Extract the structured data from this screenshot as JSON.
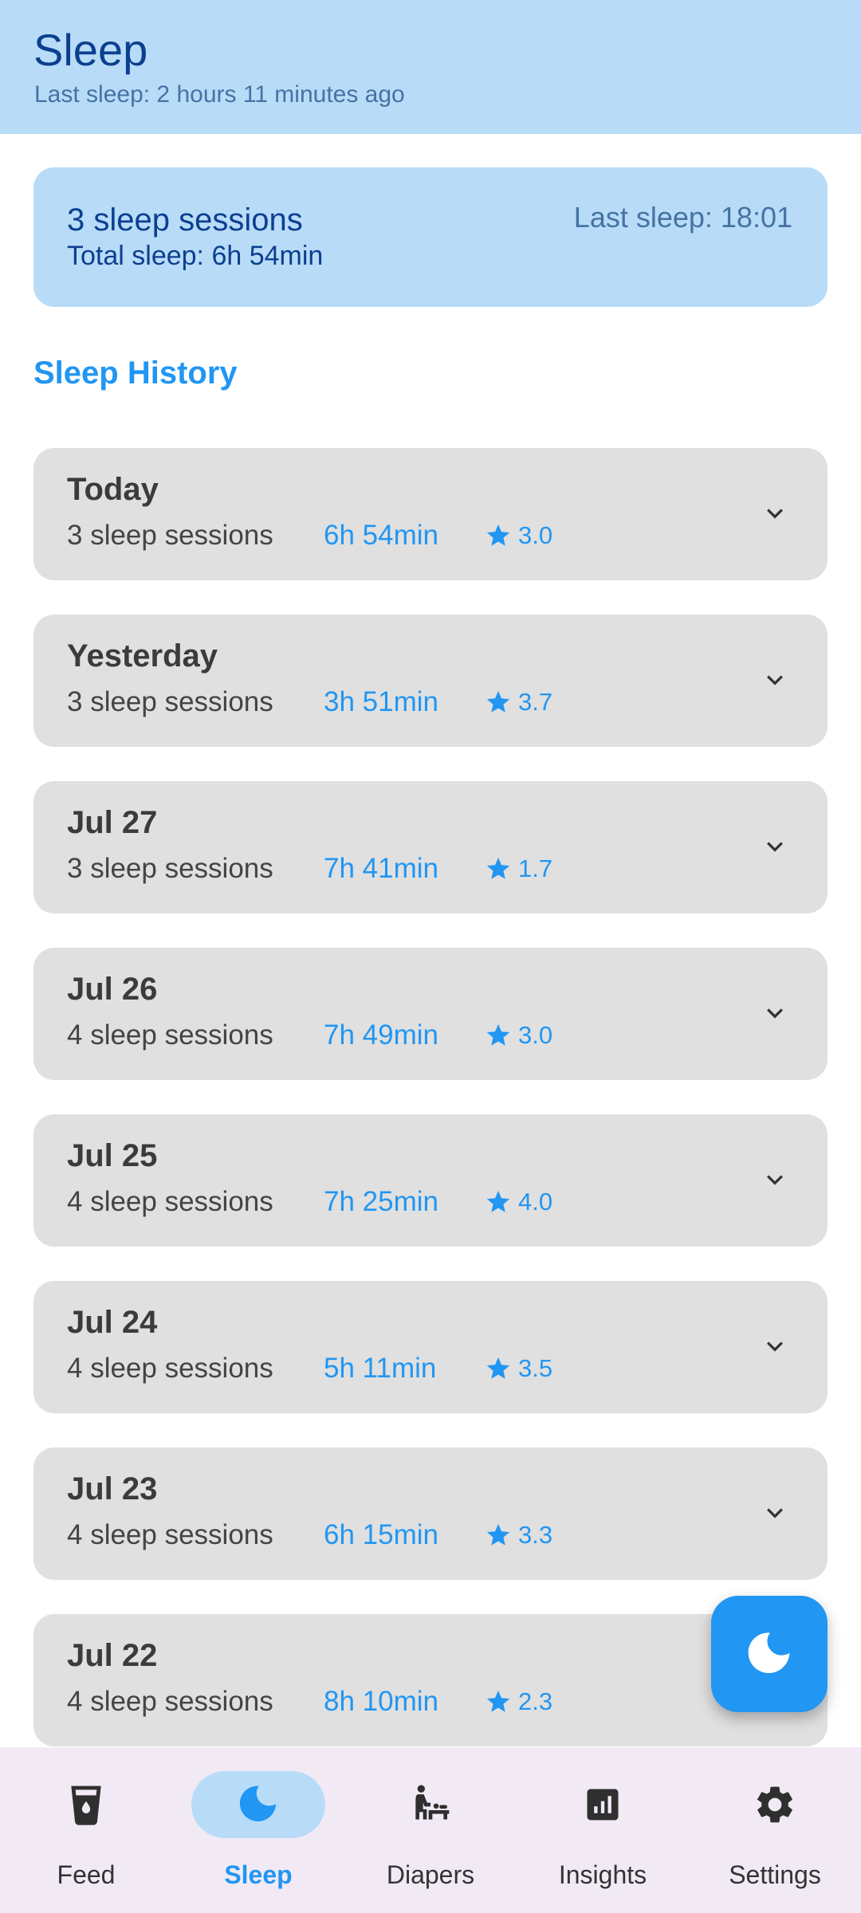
{
  "header": {
    "title": "Sleep",
    "subtitle": "Last sleep: 2 hours 11 minutes ago"
  },
  "summary": {
    "sessions": "3 sleep sessions",
    "total": "Total sleep: 6h 54min",
    "last": "Last sleep: 18:01"
  },
  "history_title": "Sleep History",
  "days": [
    {
      "label": "Today",
      "count": "3 sleep sessions",
      "duration": "6h 54min",
      "rating": "3.0"
    },
    {
      "label": "Yesterday",
      "count": "3 sleep sessions",
      "duration": "3h 51min",
      "rating": "3.7"
    },
    {
      "label": "Jul 27",
      "count": "3 sleep sessions",
      "duration": "7h 41min",
      "rating": "1.7"
    },
    {
      "label": "Jul 26",
      "count": "4 sleep sessions",
      "duration": "7h 49min",
      "rating": "3.0"
    },
    {
      "label": "Jul 25",
      "count": "4 sleep sessions",
      "duration": "7h 25min",
      "rating": "4.0"
    },
    {
      "label": "Jul 24",
      "count": "4 sleep sessions",
      "duration": "5h 11min",
      "rating": "3.5"
    },
    {
      "label": "Jul 23",
      "count": "4 sleep sessions",
      "duration": "6h 15min",
      "rating": "3.3"
    },
    {
      "label": "Jul 22",
      "count": "4 sleep sessions",
      "duration": "8h 10min",
      "rating": "2.3"
    }
  ],
  "fab_icon": "moon-icon",
  "nav": [
    {
      "label": "Feed",
      "icon": "cup-icon"
    },
    {
      "label": "Sleep",
      "icon": "moon-icon",
      "active": true
    },
    {
      "label": "Diapers",
      "icon": "baby-changing-icon"
    },
    {
      "label": "Insights",
      "icon": "bar-chart-icon"
    },
    {
      "label": "Settings",
      "icon": "gear-icon"
    }
  ],
  "colors": {
    "accent": "#2196f3",
    "header_bg": "#b8dcf8",
    "title_text": "#0d3f8f",
    "card_bg": "#e0e0e0",
    "nav_bg": "#f1eaf5"
  }
}
